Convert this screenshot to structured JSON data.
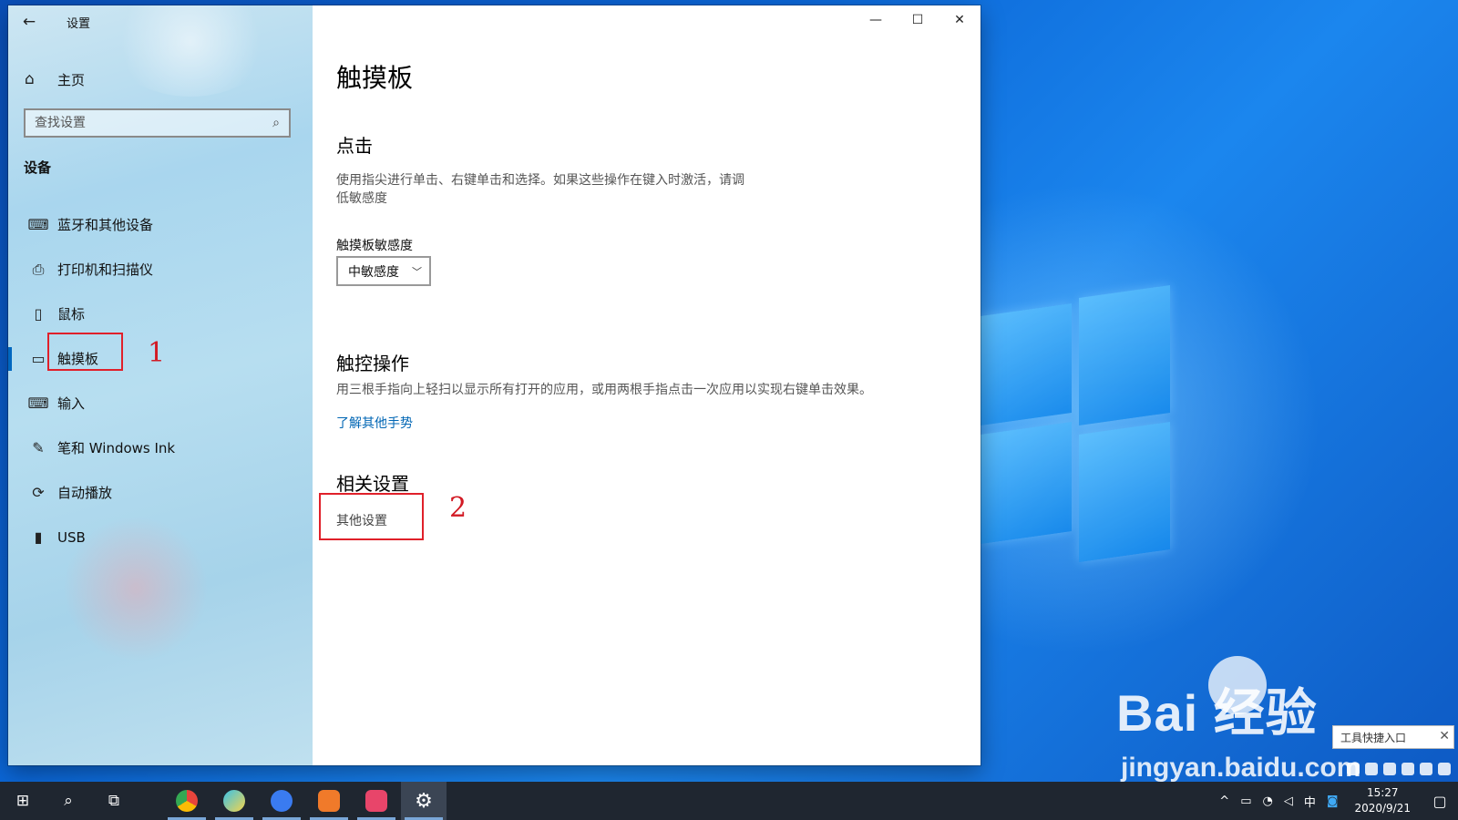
{
  "window": {
    "app_title": "设置",
    "back_icon": "←",
    "minimize_icon": "—",
    "maximize_icon": "☐",
    "close_icon": "✕"
  },
  "sidebar": {
    "home_label": "主页",
    "home_icon": "⌂",
    "search_placeholder": "查找设置",
    "search_icon": "⌕",
    "section_title": "设备",
    "items": [
      {
        "label": "蓝牙和其他设备",
        "icon": "⌨"
      },
      {
        "label": "打印机和扫描仪",
        "icon": "⎙"
      },
      {
        "label": "鼠标",
        "icon": "▯"
      },
      {
        "label": "触摸板",
        "icon": "▭"
      },
      {
        "label": "输入",
        "icon": "⌨"
      },
      {
        "label": "笔和 Windows Ink",
        "icon": "✎"
      },
      {
        "label": "自动播放",
        "icon": "⟳"
      },
      {
        "label": "USB",
        "icon": "▮"
      }
    ],
    "active_index": 3
  },
  "content": {
    "page_title": "触摸板",
    "tap_heading": "点击",
    "tap_description_line1": "使用指尖进行单击、右键单击和选择。如果这些操作在键入时激活，请调",
    "tap_description_line2": "低敏感度",
    "sensitivity_label": "触摸板敏感度",
    "sensitivity_value": "中敏感度",
    "gestures_heading": "触控操作",
    "gestures_description": "用三根手指向上轻扫以显示所有打开的应用，或用两根手指点击一次应用以实现右键单击效果。",
    "gestures_link": "了解其他手势",
    "related_heading": "相关设置",
    "related_link": "其他设置"
  },
  "annotations": {
    "mark1": "1",
    "mark2": "2",
    "color": "#e0202a"
  },
  "watermark": {
    "brand": "Bai  经验",
    "url": "jingyan.baidu.com",
    "popup_text": "工具快捷入口",
    "popup_close": "✕"
  },
  "taskbar": {
    "start_icon": "⊞",
    "search_icon": "⌕",
    "taskview_icon": "⧉",
    "apps": [
      {
        "name": "chrome-app",
        "color": "#e8453c"
      },
      {
        "name": "paint-app",
        "color": "#39c2e8"
      },
      {
        "name": "feishu-app",
        "color": "#3a7bf0"
      },
      {
        "name": "photo-app",
        "color": "#f07a2a"
      },
      {
        "name": "music-app",
        "color": "#e8456a"
      },
      {
        "name": "settings-app",
        "color": "#dcdcdc"
      }
    ],
    "tray_up": "^",
    "tray_ime": "中",
    "time": "15:27",
    "date": "2020/9/21",
    "notification_icon": "▢"
  }
}
